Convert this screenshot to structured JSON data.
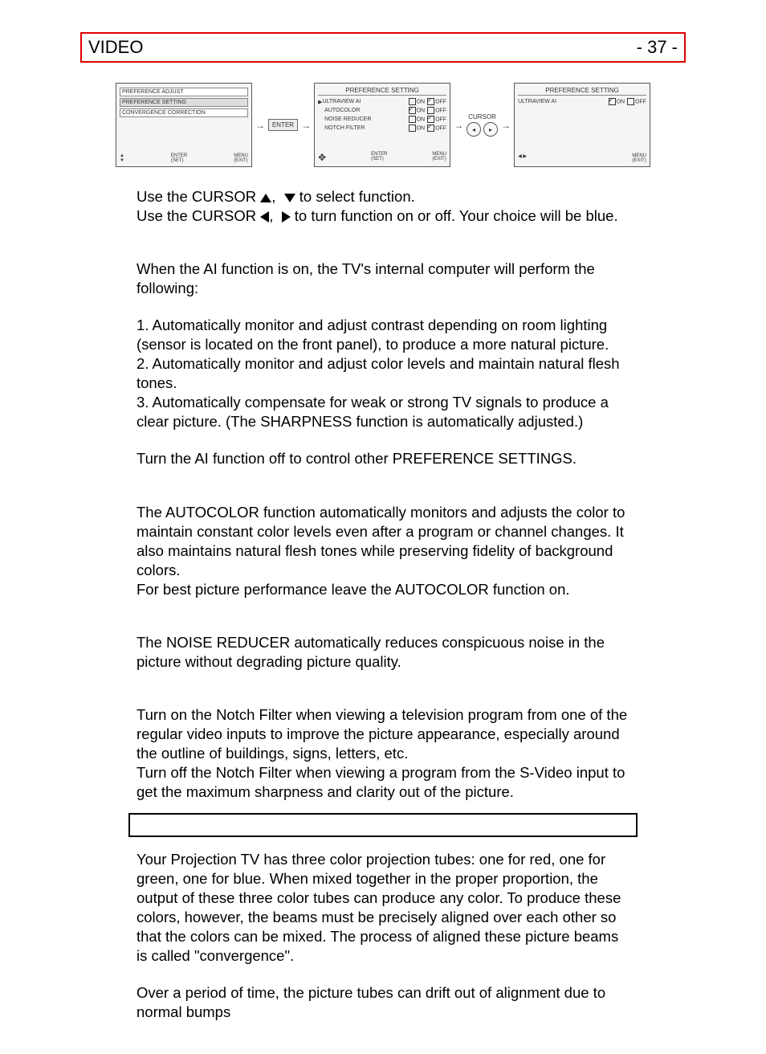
{
  "header": {
    "left": "VIDEO",
    "right": "- 37 -"
  },
  "diagram": {
    "screen1": {
      "items": [
        "PREFERENCE ADJUST",
        "PREFERENCE SETTING",
        "CONVERGENCE CORRECTION"
      ],
      "footer_enter": "ENTER",
      "footer_set": "(SET)",
      "footer_menu": "MENU",
      "footer_exit": "(EXIT)"
    },
    "enter_label": "ENTER",
    "screen2": {
      "title": "PREFERENCE SETTING",
      "rows": [
        {
          "label": "ULTRAVIEW AI",
          "on": false,
          "off": true
        },
        {
          "label": "AUTOCOLOR",
          "on": true,
          "off": false
        },
        {
          "label": "NOISE REDUCER",
          "on": false,
          "off": true
        },
        {
          "label": "NOTCH FILTER",
          "on": false,
          "off": true
        }
      ],
      "footer_enter": "ENTER",
      "footer_set": "(SET)",
      "footer_menu": "MENU",
      "footer_exit": "(EXIT)"
    },
    "cursor_label": "CURSOR",
    "screen3": {
      "title": "PREFERENCE SETTING",
      "row": {
        "label": "ULTRAVIEW AI",
        "on": true,
        "off": false
      },
      "footer_menu": "MENU",
      "footer_exit": "(EXIT)"
    },
    "on_label": "ON",
    "off_label": "OFF"
  },
  "paragraphs": {
    "cursor_ud_pre": "Use the CURSOR ",
    "cursor_ud_post": " to select function.",
    "cursor_lr_pre": "Use the CURSOR ",
    "cursor_lr_post": " to turn function on or off. Your choice will be blue.",
    "ai_intro": "When the AI function is on, the TV's internal computer will perform the following:",
    "ai_1": "1. Automatically monitor and adjust contrast depending on room lighting (sensor is located on the front panel), to produce a more natural picture.",
    "ai_2": "2. Automatically monitor and adjust color levels and maintain natural flesh tones.",
    "ai_3": "3. Automatically compensate for weak or strong TV signals to produce a clear picture. (The SHARPNESS function is automatically adjusted.)",
    "ai_off": "Turn the AI function off to control other PREFERENCE SETTINGS.",
    "autocolor_a": "The AUTOCOLOR function automatically monitors and adjusts the color to maintain constant color levels even after a program or channel changes.  It also maintains natural flesh tones while preserving fidelity of background colors.",
    "autocolor_b": "For best picture performance leave the AUTOCOLOR function on.",
    "noise": "The NOISE REDUCER automatically reduces conspicuous noise in the picture without degrading picture quality.",
    "notch_a": "Turn on the Notch Filter when viewing a television program from one of the regular video inputs to improve the picture appearance, especially around the outline of buildings, signs, letters, etc.",
    "notch_b": "Turn off the Notch Filter when viewing a program from the S-Video input to get the maximum sharpness and clarity out of the picture.",
    "convergence": "Your Projection TV has three color projection tubes: one for red, one for green, one for blue. When mixed together in the proper proportion, the output of these three color tubes can produce any color. To produce these colors, however, the beams must be precisely aligned over each other so that the colors can be mixed. The process of aligned these picture beams is called \"convergence\".",
    "drift": "Over a period of time, the picture tubes can drift out of alignment due to normal bumps"
  }
}
